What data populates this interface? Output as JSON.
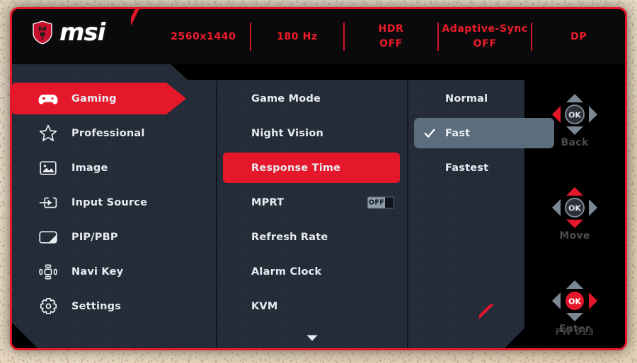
{
  "brand": {
    "logo_icon": "msi-dragon-shield-icon",
    "wordmark": "msi"
  },
  "header": {
    "resolution": "2560x1440",
    "refresh": "180 Hz",
    "hdr_label": "HDR",
    "hdr_value": "OFF",
    "adaptive_sync_label": "Adaptive-Sync",
    "adaptive_sync_value": "OFF",
    "input": "DP"
  },
  "sidebar": {
    "items": [
      {
        "label": "Gaming",
        "icon": "gamepad-icon",
        "active": true
      },
      {
        "label": "Professional",
        "icon": "star-icon",
        "active": false
      },
      {
        "label": "Image",
        "icon": "picture-icon",
        "active": false
      },
      {
        "label": "Input Source",
        "icon": "input-arrow-icon",
        "active": false
      },
      {
        "label": "PIP/PBP",
        "icon": "pip-pbp-icon",
        "active": false
      },
      {
        "label": "Navi Key",
        "icon": "navi-key-icon",
        "active": false
      },
      {
        "label": "Settings",
        "icon": "gear-icon",
        "active": false
      }
    ]
  },
  "submenu": {
    "items": [
      {
        "label": "Game Mode",
        "active": false,
        "toggle": null
      },
      {
        "label": "Night Vision",
        "active": false,
        "toggle": null
      },
      {
        "label": "Response Time",
        "active": true,
        "toggle": null
      },
      {
        "label": "MPRT",
        "active": false,
        "toggle": "OFF"
      },
      {
        "label": "Refresh Rate",
        "active": false,
        "toggle": null
      },
      {
        "label": "Alarm Clock",
        "active": false,
        "toggle": null
      },
      {
        "label": "KVM",
        "active": false,
        "toggle": null
      }
    ],
    "scroll_more_icon": "chevron-down-icon"
  },
  "options": {
    "items": [
      {
        "label": "Normal",
        "selected": false
      },
      {
        "label": "Fast",
        "selected": true
      },
      {
        "label": "Fastest",
        "selected": false
      }
    ]
  },
  "nav_rail": {
    "widgets": [
      {
        "caption": "Back",
        "icon": "dpad-back-icon"
      },
      {
        "caption": "Move",
        "icon": "dpad-move-icon"
      },
      {
        "caption": "Enter",
        "icon": "dpad-enter-icon"
      }
    ],
    "firmware": "FW 013"
  },
  "colors": {
    "accent_red": "#e5182b",
    "header_red_text": "#ed1c2a",
    "panel_navy": "#232c38",
    "option_highlight": "#5c6d7e",
    "rail_black": "#000000",
    "text_white": "#e8ecf1"
  }
}
